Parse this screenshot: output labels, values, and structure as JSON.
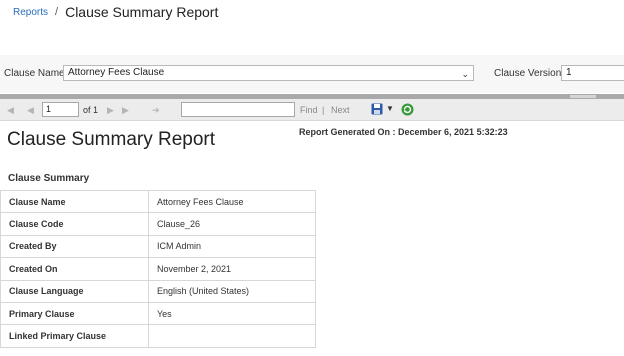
{
  "breadcrumb": {
    "link": "Reports",
    "separator": "/",
    "title": "Clause Summary Report"
  },
  "filters": {
    "clause_name_label": "Clause Name",
    "clause_name_value": "Attorney Fees Clause",
    "clause_version_label": "Clause Version",
    "clause_version_value": "1"
  },
  "toolbar": {
    "page_value": "1",
    "of_label": "of 1",
    "find_label": "Find",
    "divider": "|",
    "next_label": "Next"
  },
  "report": {
    "title": "Clause Summary Report",
    "generated": "Report Generated On : December 6, 2021 5:32:23",
    "section_title": "Clause Summary",
    "rows": [
      {
        "label": "Clause Name",
        "value": "Attorney Fees Clause"
      },
      {
        "label": "Clause Code",
        "value": "Clause_26"
      },
      {
        "label": "Created By",
        "value": "ICM Admin"
      },
      {
        "label": "Created On",
        "value": "November 2, 2021"
      },
      {
        "label": "Clause Language",
        "value": "English (United States)"
      },
      {
        "label": "Primary Clause",
        "value": "Yes"
      },
      {
        "label": "Linked Primary Clause",
        "value": ""
      }
    ]
  },
  "icons": {
    "first_page": "first-page-icon",
    "prev_page": "previous-page-icon",
    "next_page": "next-page-icon",
    "last_page": "last-page-icon",
    "back": "back-to-parent-icon",
    "export": "save-export-icon",
    "refresh": "refresh-icon"
  },
  "colors": {
    "link": "#2a6ebb",
    "toolbar_bg": "#ececec",
    "splitter": "#a9a9a9"
  }
}
